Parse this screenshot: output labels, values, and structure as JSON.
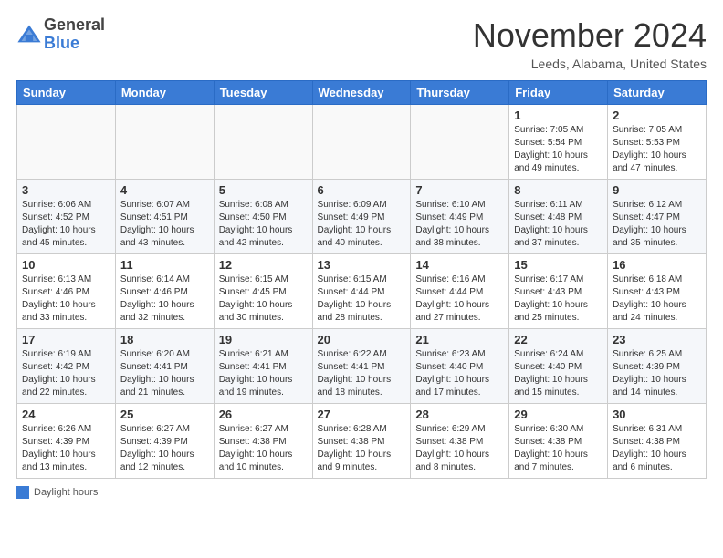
{
  "header": {
    "logo_line1": "General",
    "logo_line2": "Blue",
    "month": "November 2024",
    "location": "Leeds, Alabama, United States"
  },
  "days_of_week": [
    "Sunday",
    "Monday",
    "Tuesday",
    "Wednesday",
    "Thursday",
    "Friday",
    "Saturday"
  ],
  "weeks": [
    [
      {
        "day": "",
        "info": ""
      },
      {
        "day": "",
        "info": ""
      },
      {
        "day": "",
        "info": ""
      },
      {
        "day": "",
        "info": ""
      },
      {
        "day": "",
        "info": ""
      },
      {
        "day": "1",
        "info": "Sunrise: 7:05 AM\nSunset: 5:54 PM\nDaylight: 10 hours and 49 minutes."
      },
      {
        "day": "2",
        "info": "Sunrise: 7:05 AM\nSunset: 5:53 PM\nDaylight: 10 hours and 47 minutes."
      }
    ],
    [
      {
        "day": "3",
        "info": "Sunrise: 6:06 AM\nSunset: 4:52 PM\nDaylight: 10 hours and 45 minutes."
      },
      {
        "day": "4",
        "info": "Sunrise: 6:07 AM\nSunset: 4:51 PM\nDaylight: 10 hours and 43 minutes."
      },
      {
        "day": "5",
        "info": "Sunrise: 6:08 AM\nSunset: 4:50 PM\nDaylight: 10 hours and 42 minutes."
      },
      {
        "day": "6",
        "info": "Sunrise: 6:09 AM\nSunset: 4:49 PM\nDaylight: 10 hours and 40 minutes."
      },
      {
        "day": "7",
        "info": "Sunrise: 6:10 AM\nSunset: 4:49 PM\nDaylight: 10 hours and 38 minutes."
      },
      {
        "day": "8",
        "info": "Sunrise: 6:11 AM\nSunset: 4:48 PM\nDaylight: 10 hours and 37 minutes."
      },
      {
        "day": "9",
        "info": "Sunrise: 6:12 AM\nSunset: 4:47 PM\nDaylight: 10 hours and 35 minutes."
      }
    ],
    [
      {
        "day": "10",
        "info": "Sunrise: 6:13 AM\nSunset: 4:46 PM\nDaylight: 10 hours and 33 minutes."
      },
      {
        "day": "11",
        "info": "Sunrise: 6:14 AM\nSunset: 4:46 PM\nDaylight: 10 hours and 32 minutes."
      },
      {
        "day": "12",
        "info": "Sunrise: 6:15 AM\nSunset: 4:45 PM\nDaylight: 10 hours and 30 minutes."
      },
      {
        "day": "13",
        "info": "Sunrise: 6:15 AM\nSunset: 4:44 PM\nDaylight: 10 hours and 28 minutes."
      },
      {
        "day": "14",
        "info": "Sunrise: 6:16 AM\nSunset: 4:44 PM\nDaylight: 10 hours and 27 minutes."
      },
      {
        "day": "15",
        "info": "Sunrise: 6:17 AM\nSunset: 4:43 PM\nDaylight: 10 hours and 25 minutes."
      },
      {
        "day": "16",
        "info": "Sunrise: 6:18 AM\nSunset: 4:43 PM\nDaylight: 10 hours and 24 minutes."
      }
    ],
    [
      {
        "day": "17",
        "info": "Sunrise: 6:19 AM\nSunset: 4:42 PM\nDaylight: 10 hours and 22 minutes."
      },
      {
        "day": "18",
        "info": "Sunrise: 6:20 AM\nSunset: 4:41 PM\nDaylight: 10 hours and 21 minutes."
      },
      {
        "day": "19",
        "info": "Sunrise: 6:21 AM\nSunset: 4:41 PM\nDaylight: 10 hours and 19 minutes."
      },
      {
        "day": "20",
        "info": "Sunrise: 6:22 AM\nSunset: 4:41 PM\nDaylight: 10 hours and 18 minutes."
      },
      {
        "day": "21",
        "info": "Sunrise: 6:23 AM\nSunset: 4:40 PM\nDaylight: 10 hours and 17 minutes."
      },
      {
        "day": "22",
        "info": "Sunrise: 6:24 AM\nSunset: 4:40 PM\nDaylight: 10 hours and 15 minutes."
      },
      {
        "day": "23",
        "info": "Sunrise: 6:25 AM\nSunset: 4:39 PM\nDaylight: 10 hours and 14 minutes."
      }
    ],
    [
      {
        "day": "24",
        "info": "Sunrise: 6:26 AM\nSunset: 4:39 PM\nDaylight: 10 hours and 13 minutes."
      },
      {
        "day": "25",
        "info": "Sunrise: 6:27 AM\nSunset: 4:39 PM\nDaylight: 10 hours and 12 minutes."
      },
      {
        "day": "26",
        "info": "Sunrise: 6:27 AM\nSunset: 4:38 PM\nDaylight: 10 hours and 10 minutes."
      },
      {
        "day": "27",
        "info": "Sunrise: 6:28 AM\nSunset: 4:38 PM\nDaylight: 10 hours and 9 minutes."
      },
      {
        "day": "28",
        "info": "Sunrise: 6:29 AM\nSunset: 4:38 PM\nDaylight: 10 hours and 8 minutes."
      },
      {
        "day": "29",
        "info": "Sunrise: 6:30 AM\nSunset: 4:38 PM\nDaylight: 10 hours and 7 minutes."
      },
      {
        "day": "30",
        "info": "Sunrise: 6:31 AM\nSunset: 4:38 PM\nDaylight: 10 hours and 6 minutes."
      }
    ]
  ],
  "legend": {
    "color_label": "Daylight hours"
  }
}
